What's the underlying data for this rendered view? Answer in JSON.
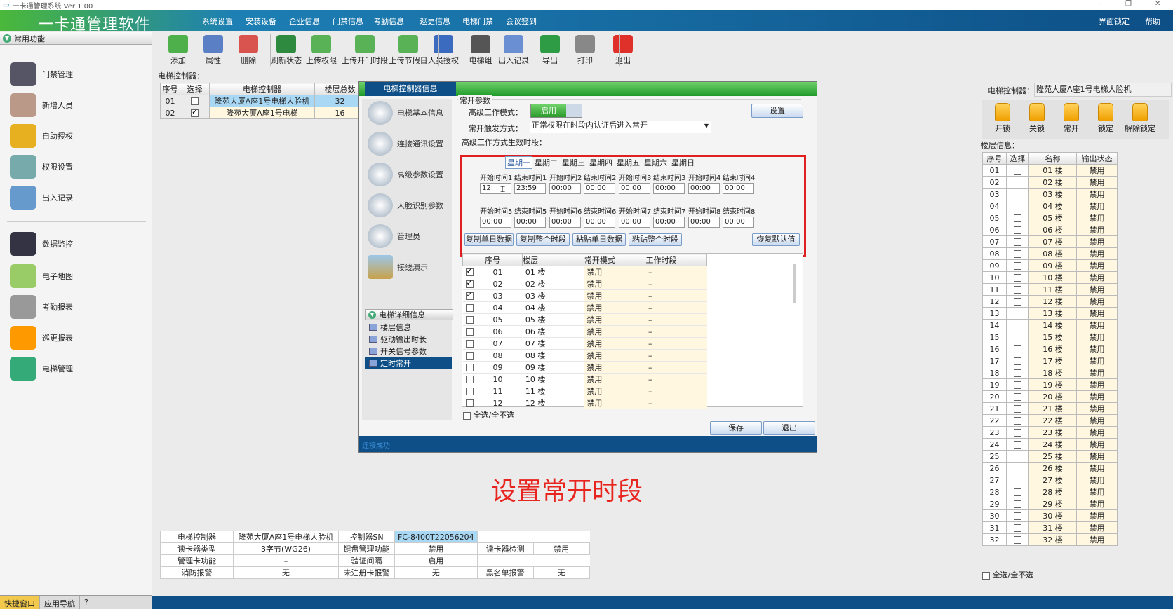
{
  "window": {
    "title": "一卡通管理系统  Ver 1.00",
    "min": "–",
    "max": "❐",
    "close": "✕"
  },
  "header": {
    "app_title": "一卡通管理软件",
    "menus": [
      "系统设置",
      "安装设备",
      "企业信息",
      "门禁信息",
      "考勤信息",
      "巡更信息",
      "电梯门禁",
      "会议签到"
    ],
    "right": [
      "界面锁定",
      "帮助"
    ]
  },
  "toolbar": [
    "添加",
    "属性",
    "删除",
    "刷新状态",
    "上传权限",
    "上传开门时段",
    "上传节假日",
    "人员授权",
    "电梯组",
    "出入记录",
    "导出",
    "打印",
    "退出"
  ],
  "leftnav": {
    "header": "常用功能",
    "items": [
      "门禁管理",
      "新增人员",
      "自助授权",
      "权限设置",
      "出入记录",
      "数据监控",
      "电子地图",
      "考勤报表",
      "巡更报表",
      "电梯管理"
    ],
    "bottom_tabs": [
      "快捷窗口",
      "应用导航",
      "?"
    ]
  },
  "main": {
    "controller_label": "电梯控制器：",
    "ctrl_headers": [
      "序号",
      "选择",
      "电梯控制器",
      "楼层总数"
    ],
    "ctrl_rows": [
      {
        "no": "01",
        "checked": false,
        "name": "隆苑大厦A座1号电梯人脸机",
        "floors": "32"
      },
      {
        "no": "02",
        "checked": true,
        "name": "隆苑大厦A座1号电梯",
        "floors": "16"
      }
    ],
    "info": [
      [
        "电梯控制器",
        "隆苑大厦A座1号电梯人脸机",
        "控制器SN",
        "FC-8400T22056204"
      ],
      [
        "读卡器类型",
        "3字节(WG26)",
        "键盘管理功能",
        "禁用",
        "读卡器检测",
        "禁用"
      ],
      [
        "管理卡功能",
        "–",
        "验证间隔",
        "启用"
      ],
      [
        "消防报警",
        "无",
        "未注册卡报警",
        "无",
        "黑名单报警",
        "无"
      ]
    ]
  },
  "dialog": {
    "title": "电梯控制器信息",
    "side": [
      "电梯基本信息",
      "连接通讯设置",
      "高级参数设置",
      "人脸识别参数",
      "管理员",
      "接线演示"
    ],
    "sub_header": "电梯详细信息",
    "sub_items": [
      "楼层信息",
      "驱动输出时长",
      "开关信号参数",
      "定时常开"
    ],
    "group": "常开参数",
    "mode_label": "高级工作模式：",
    "mode_value": "启用",
    "set_btn": "设置",
    "trigger_label": "常开触发方式：",
    "trigger_value": "正常权限在时段内认证后进入常开",
    "period_label": "高级工作方式生效时段：",
    "weekdays": [
      "星期一",
      "星期二",
      "星期三",
      "星期四",
      "星期五",
      "星期六",
      "星期日"
    ],
    "times_row1": [
      {
        "s": "开始时间1",
        "e": "结束时间1",
        "sv": "12:",
        "ev": "23:59"
      },
      {
        "s": "开始时间2",
        "e": "结束时间2",
        "sv": "00:00",
        "ev": "00:00"
      },
      {
        "s": "开始时间3",
        "e": "结束时间3",
        "sv": "00:00",
        "ev": "00:00"
      },
      {
        "s": "开始时间4",
        "e": "结束时间4",
        "sv": "00:00",
        "ev": "00:00"
      }
    ],
    "times_row2": [
      {
        "s": "开始时间5",
        "e": "结束时间5",
        "sv": "00:00",
        "ev": "00:00"
      },
      {
        "s": "开始时间6",
        "e": "结束时间6",
        "sv": "00:00",
        "ev": "00:00"
      },
      {
        "s": "开始时间7",
        "e": "结束时间7",
        "sv": "00:00",
        "ev": "00:00"
      },
      {
        "s": "开始时间8",
        "e": "结束时间8",
        "sv": "00:00",
        "ev": "00:00"
      }
    ],
    "buttons": [
      "复制单日数据",
      "复制整个时段",
      "粘贴单日数据",
      "粘贴整个时段",
      "恢复默认值"
    ],
    "list_headers": [
      "序号",
      "楼层",
      "常开模式",
      "工作时段"
    ],
    "list_rows": [
      {
        "no": "01",
        "floor": "01 楼",
        "mode": "禁用",
        "period": "–",
        "c": true
      },
      {
        "no": "02",
        "floor": "02 楼",
        "mode": "禁用",
        "period": "–",
        "c": true
      },
      {
        "no": "03",
        "floor": "03 楼",
        "mode": "禁用",
        "period": "–",
        "c": true
      },
      {
        "no": "04",
        "floor": "04 楼",
        "mode": "禁用",
        "period": "–",
        "c": false
      },
      {
        "no": "05",
        "floor": "05 楼",
        "mode": "禁用",
        "period": "–",
        "c": false
      },
      {
        "no": "06",
        "floor": "06 楼",
        "mode": "禁用",
        "period": "–",
        "c": false
      },
      {
        "no": "07",
        "floor": "07 楼",
        "mode": "禁用",
        "period": "–",
        "c": false
      },
      {
        "no": "08",
        "floor": "08 楼",
        "mode": "禁用",
        "period": "–",
        "c": false
      },
      {
        "no": "09",
        "floor": "09 楼",
        "mode": "禁用",
        "period": "–",
        "c": false
      },
      {
        "no": "10",
        "floor": "10 楼",
        "mode": "禁用",
        "period": "–",
        "c": false
      },
      {
        "no": "11",
        "floor": "11 楼",
        "mode": "禁用",
        "period": "–",
        "c": false
      },
      {
        "no": "12",
        "floor": "12 楼",
        "mode": "禁用",
        "period": "–",
        "c": false
      }
    ],
    "select_all": "全选/全不选",
    "save": "保存",
    "exit": "退出",
    "status": "连接成功"
  },
  "right": {
    "ctrl_label": "电梯控制器：",
    "ctrl_value": "隆苑大厦A座1号电梯人脸机",
    "locks": [
      "开锁",
      "关锁",
      "常开",
      "锁定",
      "解除锁定"
    ],
    "floor_label": "楼层信息：",
    "floor_headers": [
      "序号",
      "选择",
      "名称",
      "输出状态"
    ],
    "floor_state": "禁用",
    "select_all": "全选/全不选"
  },
  "caption": "设置常开时段"
}
